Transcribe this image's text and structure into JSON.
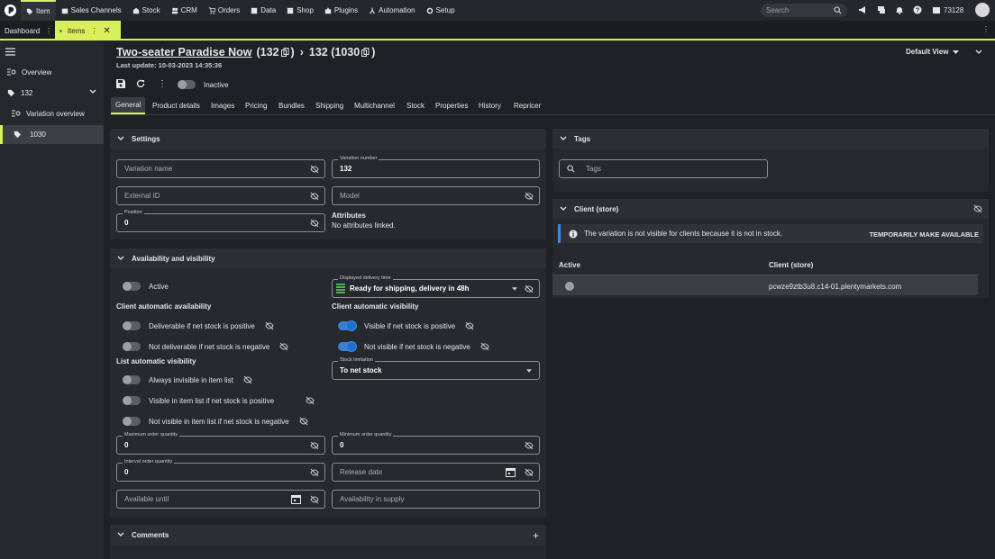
{
  "topbar": {
    "nav": [
      {
        "label": "Item",
        "icon": "tag-icon"
      },
      {
        "label": "Sales Channels",
        "icon": "store-icon"
      },
      {
        "label": "Stock",
        "icon": "stock-icon"
      },
      {
        "label": "CRM",
        "icon": "people-icon"
      },
      {
        "label": "Orders",
        "icon": "cart-icon"
      },
      {
        "label": "Data",
        "icon": "data-icon"
      },
      {
        "label": "Shop",
        "icon": "shop-icon"
      },
      {
        "label": "Plugins",
        "icon": "puzzle-icon"
      },
      {
        "label": "Automation",
        "icon": "automation-icon"
      },
      {
        "label": "Setup",
        "icon": "gear-icon"
      }
    ],
    "search_placeholder": "Search",
    "account_id": "73128"
  },
  "tabs": {
    "dashboard": "Dashboard",
    "items": "Items"
  },
  "sidebar": {
    "items": [
      {
        "label": "Overview"
      },
      {
        "label": "132"
      },
      {
        "label": "Variation overview"
      },
      {
        "label": "1030"
      }
    ]
  },
  "header": {
    "item_name": "Two-seater Paradise Now",
    "item_id": "(132",
    "crumb_sep": "›",
    "variation": "132 (1030",
    "close_paren": ")",
    "last_update": "Last update: 10-03-2023 14:35:36",
    "view": "Default View"
  },
  "toolbar": {
    "status": "Inactive"
  },
  "subtabs": [
    "General",
    "Product details",
    "Images",
    "Pricing",
    "Bundles",
    "Shipping",
    "Multichannel",
    "Stock",
    "Properties",
    "History",
    "Repricer"
  ],
  "settings": {
    "title": "Settings",
    "variation_name_ph": "Variation name",
    "variation_number_label": "Variation number",
    "variation_number": "132",
    "external_id_ph": "External ID",
    "model_ph": "Model",
    "position_label": "Position",
    "position": "0",
    "attributes_title": "Attributes",
    "attributes_text": "No attributes linked."
  },
  "availability": {
    "title": "Availability and visibility",
    "active": "Active",
    "delivery_label": "Displayed delivery time",
    "delivery_value": "Ready for shipping, delivery in 48h",
    "client_auto_avail": "Client automatic availability",
    "deliverable": "Deliverable if net stock is positive",
    "not_deliverable": "Not deliverable if net stock is negative",
    "client_auto_vis": "Client automatic visibility",
    "visible_pos": "Visible if net stock is positive",
    "not_visible_neg": "Not visible if net stock is negative",
    "list_auto_vis": "List automatic visibility",
    "always_invisible": "Always invisible in item list",
    "visible_list_pos": "Visible in item list if net stock is positive",
    "not_visible_list_neg": "Not visible in item list if net stock is negative",
    "stock_limit_label": "Stock limitation",
    "stock_limit_value": "To net stock",
    "max_order_label": "Maximum order quantity",
    "max_order": "0",
    "min_order_label": "Minimum order quantity",
    "min_order": "0",
    "interval_label": "Interval order quantity",
    "interval": "0",
    "release_ph": "Release date",
    "available_until_ph": "Available until",
    "availability_supply_ph": "Availability in supply"
  },
  "comments": {
    "title": "Comments"
  },
  "tags": {
    "title": "Tags",
    "placeholder": "Tags"
  },
  "client_store": {
    "title": "Client (store)",
    "notice": "The variation is not visible for clients because it is not in stock.",
    "action": "TEMPORARILY MAKE AVAILABLE",
    "col_active": "Active",
    "col_client": "Client (store)",
    "row_client": "pcwze9ztb3u8.c14-01.plentymarkets.com"
  },
  "colors": {
    "accent": "#d9ef5b",
    "toggle_on": "#1f6fd1",
    "delivery_green": "#4caf50"
  }
}
